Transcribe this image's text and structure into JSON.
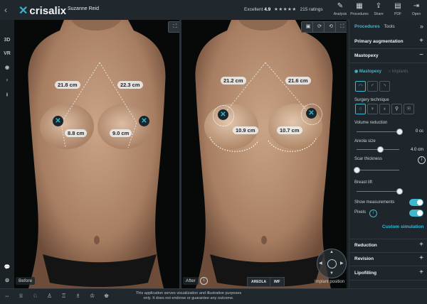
{
  "topbar": {
    "back_icon": "chevron-left-icon",
    "brand": "crisalix",
    "patient_name": "Suzanne Reid",
    "rating_label": "Excellent",
    "rating_value": "4.9",
    "stars": "★★★★★",
    "ratings_count": "215 ratings",
    "buttons": [
      {
        "label": "Analysis",
        "icon": "✎"
      },
      {
        "label": "Procedures",
        "icon": "▦"
      },
      {
        "label": "Share",
        "icon": "⇪"
      },
      {
        "label": "PDF",
        "icon": "▤"
      },
      {
        "label": "Open",
        "icon": "⇥"
      }
    ]
  },
  "leftbar": {
    "items": [
      {
        "name": "3d-view-button",
        "label": "3D"
      },
      {
        "name": "vr-button",
        "label": "VR"
      },
      {
        "name": "record-button",
        "label": "◉"
      },
      {
        "name": "body-button",
        "label": "♀"
      },
      {
        "name": "download-button",
        "label": "⭳"
      }
    ],
    "chat_icon": "💬",
    "settings_icon": "⚙"
  },
  "viewer_left": {
    "label": "Before",
    "measurements": [
      "21.8 cm",
      "22.3 cm",
      "8.8 cm",
      "9.0 cm"
    ],
    "fullscreen_icon": "⛶"
  },
  "viewer_right": {
    "label": "After",
    "measurements": [
      "21.2 cm",
      "21.6 cm",
      "10.9 cm",
      "10.7 cm"
    ],
    "toolbar_icons": [
      "▣",
      "⟳",
      "⟲",
      "⛶"
    ],
    "segments": [
      "AREOLA",
      "IMF"
    ],
    "implant_position": "Implant position"
  },
  "panel": {
    "tab_active": "Procedures",
    "tab_other": "Tools",
    "collapse_icon": "»",
    "primary": "Primary augmentation",
    "mastopexy": "Mastopexy",
    "subtab_active": "Mastopexy",
    "subtab_inactive": "Implants",
    "surgery_technique": "Surgery technique",
    "volume_reduction": "Volume reduction",
    "volume_value": "0 cc",
    "areola_size": "Areola size",
    "areola_value": "4.0 cm",
    "scar_thickness": "Scar thickness",
    "breast_lift": "Breast lift",
    "show_measurements": "Show measurements",
    "pixels": "Pixels",
    "custom_simulation": "Custom simulation",
    "reduction": "Reduction",
    "revision": "Revision",
    "lipofilling": "Lipofilling",
    "plus": "+",
    "minus": "−",
    "sliders": {
      "volume": 1.0,
      "areola": 0.55,
      "scar": 0.0,
      "lift": 1.0
    }
  },
  "bottombar": {
    "disclaimer_line1": "This application serves visualization and illustrative purposes",
    "disclaimer_line2": "only. It does not endorse or guarantee any outcome."
  }
}
